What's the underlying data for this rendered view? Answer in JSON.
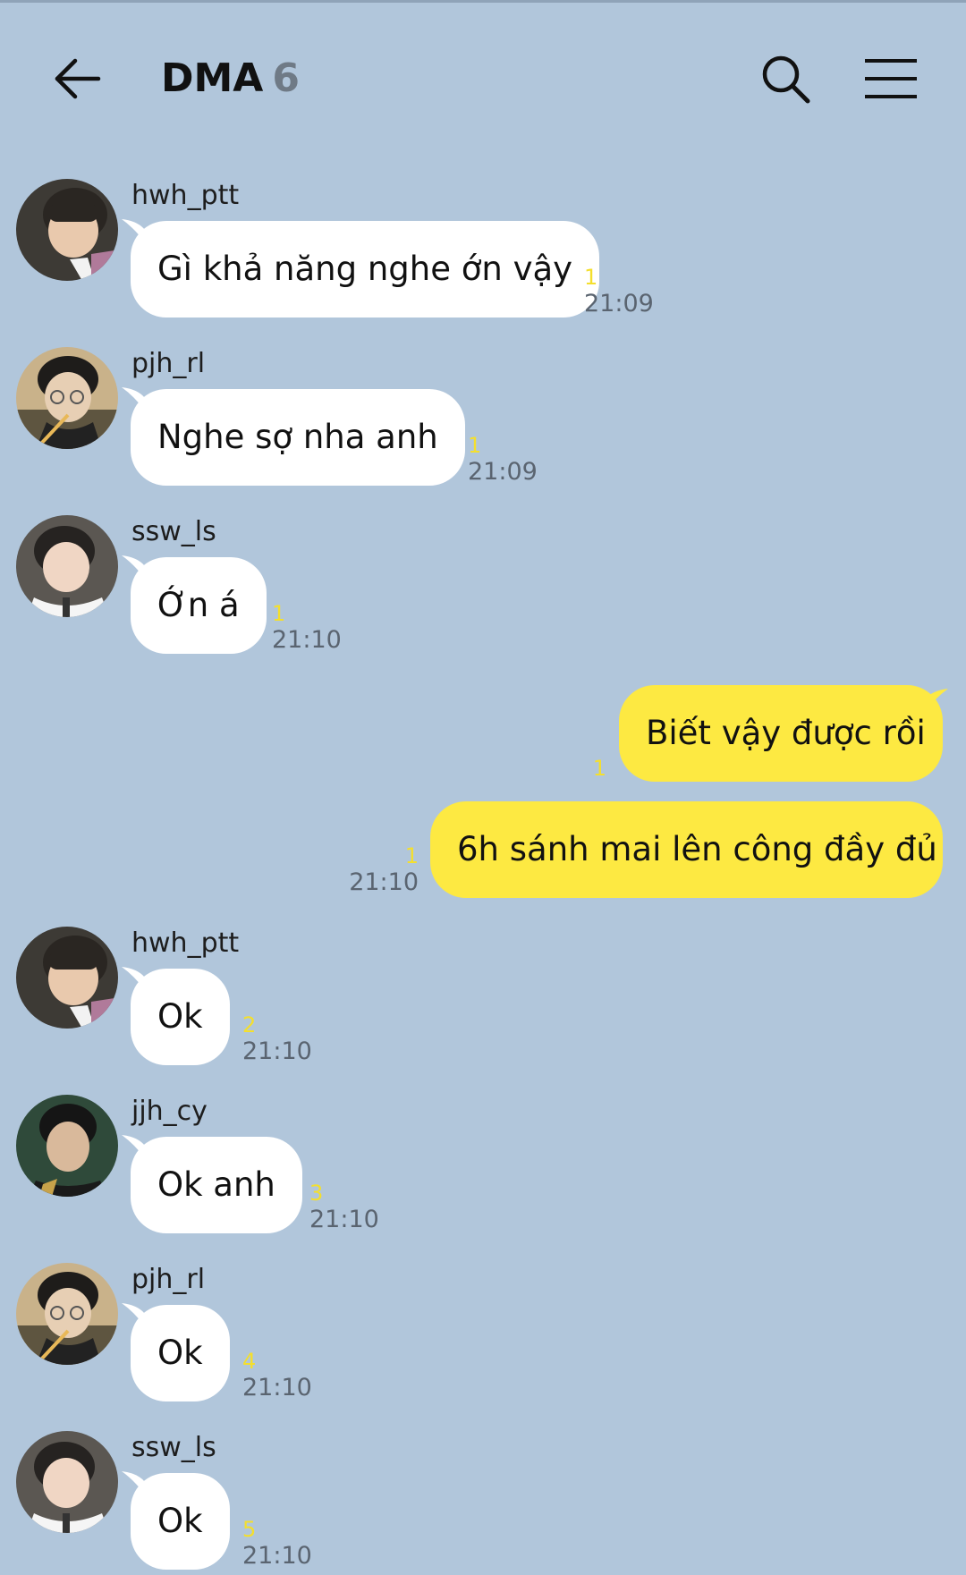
{
  "header": {
    "title": "DMA",
    "member_count": "6"
  },
  "icons": {
    "back": "arrow-left-icon",
    "search": "search-icon",
    "menu": "hamburger-menu-icon"
  },
  "colors": {
    "background": "#b1c6db",
    "incoming_bubble": "#ffffff",
    "outgoing_bubble": "#fde942",
    "unread_count": "#f4df2d"
  },
  "messages": [
    {
      "sender": "hwh_ptt",
      "text": "Gì khả năng nghe ớn vậy",
      "unread": "1",
      "time": "21:09",
      "direction": "in"
    },
    {
      "sender": "pjh_rl",
      "text": "Nghe sợ nha anh",
      "unread": "1",
      "time": "21:09",
      "direction": "in"
    },
    {
      "sender": "ssw_ls",
      "text": "Ớn á",
      "unread": "1",
      "time": "21:10",
      "direction": "in"
    },
    {
      "sender": "",
      "text": "Biết vậy được rồi",
      "unread": "1",
      "time": "",
      "direction": "out"
    },
    {
      "sender": "",
      "text": "6h sánh mai lên công đầy đủ",
      "unread": "1",
      "time": "21:10",
      "direction": "out"
    },
    {
      "sender": "hwh_ptt",
      "text": "Ok",
      "unread": "2",
      "time": "21:10",
      "direction": "in"
    },
    {
      "sender": "jjh_cy",
      "text": "Ok anh",
      "unread": "3",
      "time": "21:10",
      "direction": "in"
    },
    {
      "sender": "pjh_rl",
      "text": "Ok",
      "unread": "4",
      "time": "21:10",
      "direction": "in"
    },
    {
      "sender": "ssw_ls",
      "text": "Ok",
      "unread": "5",
      "time": "21:10",
      "direction": "in"
    }
  ]
}
